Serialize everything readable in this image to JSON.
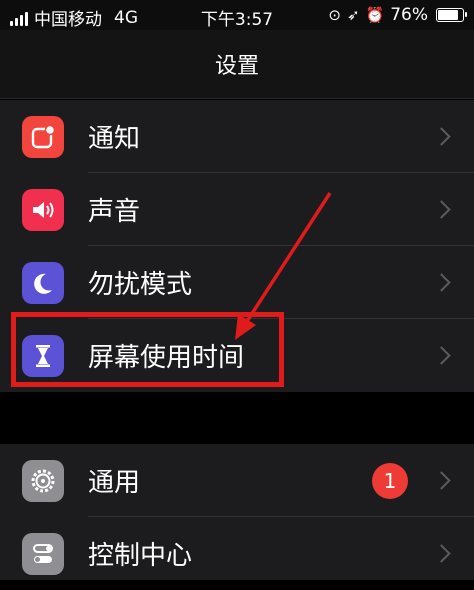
{
  "status_bar": {
    "carrier": "中国移动",
    "network": "4G",
    "time": "下午3:57",
    "battery_percent_label": "76%",
    "battery_level": 0.76
  },
  "nav": {
    "title": "设置"
  },
  "groups": [
    {
      "items": [
        {
          "label": "通知",
          "icon": "notifications-icon",
          "icon_color": "#f2453d"
        },
        {
          "label": "声音",
          "icon": "sound-icon",
          "icon_color": "#f1304f"
        },
        {
          "label": "勿扰模式",
          "icon": "do-not-disturb-moon-icon",
          "icon_color": "#5b52d6"
        },
        {
          "label": "屏幕使用时间",
          "icon": "screen-time-hourglass-icon",
          "icon_color": "#5b52d6"
        }
      ]
    },
    {
      "items": [
        {
          "label": "通用",
          "icon": "general-gear-icon",
          "icon_color": "#8e8e93",
          "badge": "1"
        },
        {
          "label": "控制中心",
          "icon": "control-center-toggles-icon",
          "icon_color": "#8e8e93"
        }
      ]
    }
  ],
  "annotation": {
    "highlight_color": "#e01b1b"
  }
}
